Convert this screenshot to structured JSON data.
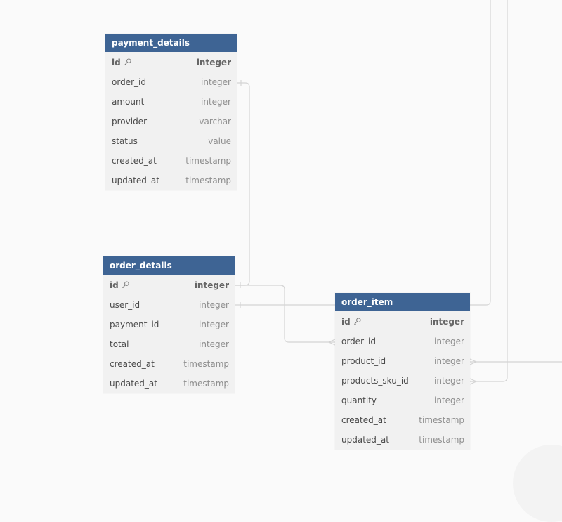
{
  "diagram": {
    "colors": {
      "header_bg": "#3e6494",
      "header_text": "#ffffff",
      "body_bg": "#f1f1f1",
      "connector": "#d4d4d4",
      "canvas_bg": "#fafafa"
    },
    "tables": [
      {
        "name": "payment_details",
        "columns": [
          {
            "name": "id",
            "type": "integer",
            "primary_key": true,
            "icon": "key-icon"
          },
          {
            "name": "order_id",
            "type": "integer"
          },
          {
            "name": "amount",
            "type": "integer"
          },
          {
            "name": "provider",
            "type": "varchar"
          },
          {
            "name": "status",
            "type": "value"
          },
          {
            "name": "created_at",
            "type": "timestamp"
          },
          {
            "name": "updated_at",
            "type": "timestamp"
          }
        ]
      },
      {
        "name": "order_details",
        "columns": [
          {
            "name": "id",
            "type": "integer",
            "primary_key": true,
            "icon": "key-icon"
          },
          {
            "name": "user_id",
            "type": "integer"
          },
          {
            "name": "payment_id",
            "type": "integer"
          },
          {
            "name": "total",
            "type": "integer"
          },
          {
            "name": "created_at",
            "type": "timestamp"
          },
          {
            "name": "updated_at",
            "type": "timestamp"
          }
        ]
      },
      {
        "name": "order_item",
        "columns": [
          {
            "name": "id",
            "type": "integer",
            "primary_key": true,
            "icon": "key-icon"
          },
          {
            "name": "order_id",
            "type": "integer"
          },
          {
            "name": "product_id",
            "type": "integer"
          },
          {
            "name": "products_sku_id",
            "type": "integer"
          },
          {
            "name": "quantity",
            "type": "integer"
          },
          {
            "name": "created_at",
            "type": "timestamp"
          },
          {
            "name": "updated_at",
            "type": "timestamp"
          }
        ]
      }
    ],
    "relationships": [
      {
        "from": "payment_details.order_id",
        "to": "order_details.id",
        "cardinality": "one-to-one"
      },
      {
        "from": "order_details.id",
        "to": "order_item.order_id",
        "cardinality": "one-to-many"
      },
      {
        "from": "order_details.user_id",
        "to": "offscreen-table",
        "cardinality": "one"
      },
      {
        "from": "order_item.product_id",
        "to": "offscreen-table",
        "cardinality": "many"
      },
      {
        "from": "order_item.products_sku_id",
        "to": "offscreen-table",
        "cardinality": "many"
      }
    ]
  }
}
